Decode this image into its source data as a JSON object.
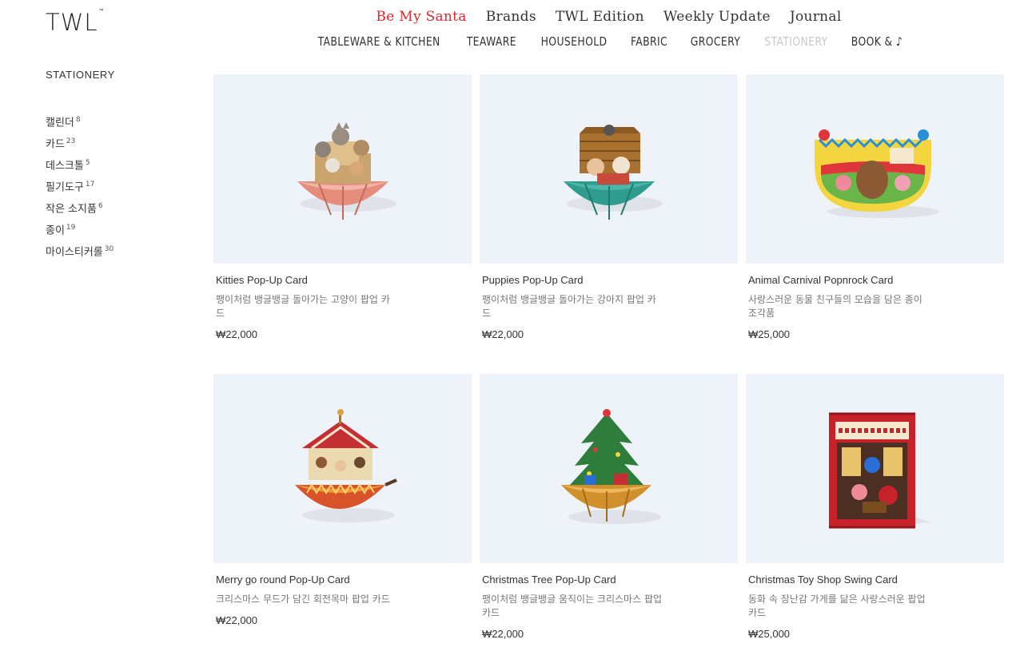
{
  "logo": {
    "text": "TWL",
    "mark": "™"
  },
  "top_nav": [
    {
      "label": "Be My Santa",
      "accent": true
    },
    {
      "label": "Brands"
    },
    {
      "label": "TWL Edition"
    },
    {
      "label": "Weekly Update"
    },
    {
      "label": "Journal"
    }
  ],
  "category_nav": [
    {
      "label": "TABLEWARE & KITCHEN"
    },
    {
      "label": "TEAWARE"
    },
    {
      "label": "HOUSEHOLD"
    },
    {
      "label": "FABRIC"
    },
    {
      "label": "GROCERY"
    },
    {
      "label": "STATIONERY",
      "active": true
    },
    {
      "label": "BOOK & ♪"
    }
  ],
  "sidebar": {
    "title": "STATIONERY",
    "items": [
      {
        "label": "캘린더",
        "count": "8"
      },
      {
        "label": "카드",
        "count": "23"
      },
      {
        "label": "데스크톨",
        "count": "5"
      },
      {
        "label": "필기도구",
        "count": "17"
      },
      {
        "label": "작은 소지품",
        "count": "6"
      },
      {
        "label": "종이",
        "count": "19"
      },
      {
        "label": "마이스티커롤",
        "count": "30"
      }
    ]
  },
  "products": [
    {
      "name": "Kitties Pop-Up Card",
      "desc": "팽이처럼 뱅글뱅글 돌아가는 고양이 팝업 카드",
      "price": "₩22,000",
      "image": "kitties-popup-card"
    },
    {
      "name": "Puppies Pop-Up Card",
      "desc": "팽이처럼 뱅글뱅글 돌아가는 강아지 팝업 카드",
      "price": "₩22,000",
      "image": "puppies-popup-card"
    },
    {
      "name": "Animal Carnival Popnrock Card",
      "desc": "사랑스러운 동물 친구들의 모습을 담은 종이 조각품",
      "price": "₩25,000",
      "image": "animal-carnival-card"
    },
    {
      "name": "Merry go round Pop-Up Card",
      "desc": "크리스마스 무드가 담긴 회전목마 팝업 카드",
      "price": "₩22,000",
      "image": "merry-go-round-card"
    },
    {
      "name": "Christmas Tree Pop-Up Card",
      "desc": "팽이처럼 뱅글뱅글 움직이는 크리스마스 팝업 카드",
      "price": "₩22,000",
      "image": "christmas-tree-card"
    },
    {
      "name": "Christmas Toy Shop Swing Card",
      "desc": "동화 속 장난감 가게를 닮은 사랑스러운 팝업 카드",
      "price": "₩25,000",
      "image": "toy-shop-card"
    }
  ],
  "colors": {
    "accent": "#e32428",
    "thumb_bg": "#eef3fa",
    "inactive_nav": "#c8c8c8"
  }
}
